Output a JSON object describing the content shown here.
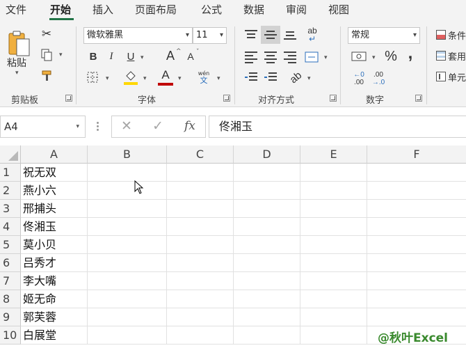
{
  "tabs": [
    {
      "label": "文件"
    },
    {
      "label": "开始"
    },
    {
      "label": "插入"
    },
    {
      "label": "页面布局"
    },
    {
      "label": "公式"
    },
    {
      "label": "数据"
    },
    {
      "label": "审阅"
    },
    {
      "label": "视图"
    }
  ],
  "ribbon": {
    "clipboard": {
      "paste_label": "粘贴",
      "group_label": "剪贴板"
    },
    "font": {
      "font_name": "微软雅黑",
      "font_size": "11",
      "bold": "B",
      "italic": "I",
      "underline": "U",
      "grow": "A",
      "shrink": "A",
      "font_color_glyph": "A",
      "phonetic_top": "wén",
      "phonetic_bottom": "文",
      "group_label": "字体"
    },
    "alignment": {
      "group_label": "对齐方式",
      "wrap_glyph": "ab"
    },
    "number": {
      "format": "常规",
      "percent": "%",
      "comma": ",",
      "dec_inc_top": "←0",
      "dec_inc_bottom": ".00",
      "dec_dec_top": ".00",
      "dec_dec_bottom": "→.0",
      "group_label": "数字"
    },
    "styles": {
      "items": [
        "条件",
        "套用",
        "单元"
      ]
    }
  },
  "formula_bar": {
    "name_box": "A4",
    "cancel": "✕",
    "enter": "✓",
    "fx": "fx",
    "value": "佟湘玉"
  },
  "grid": {
    "columns": [
      "A",
      "B",
      "C",
      "D",
      "E",
      "F"
    ],
    "rows": [
      {
        "num": "1",
        "a": "祝无双"
      },
      {
        "num": "2",
        "a": "燕小六"
      },
      {
        "num": "3",
        "a": "邢捕头"
      },
      {
        "num": "4",
        "a": "佟湘玉"
      },
      {
        "num": "5",
        "a": "莫小贝"
      },
      {
        "num": "6",
        "a": "吕秀才"
      },
      {
        "num": "7",
        "a": "李大嘴"
      },
      {
        "num": "8",
        "a": "姬无命"
      },
      {
        "num": "9",
        "a": "郭芙蓉"
      },
      {
        "num": "10",
        "a": "白展堂"
      }
    ]
  },
  "watermark": "@秋叶Excel",
  "colors": {
    "accent": "#217346",
    "font_color": "#c00000",
    "fill_color": "#ffd700"
  }
}
